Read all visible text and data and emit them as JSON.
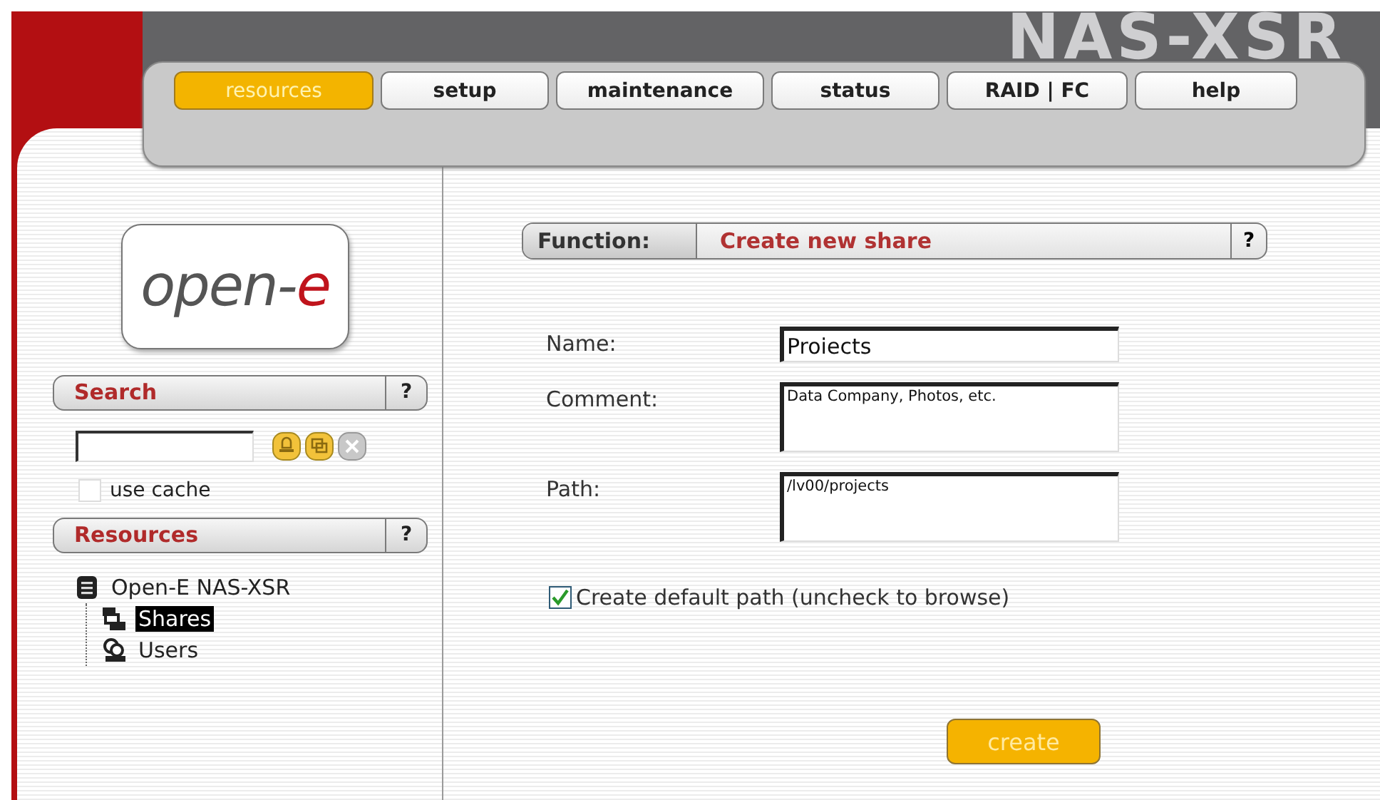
{
  "brand": {
    "title": "NAS-XSR"
  },
  "nav": {
    "tabs": [
      {
        "label": "resources",
        "selected": true
      },
      {
        "label": "setup",
        "selected": false
      },
      {
        "label": "maintenance",
        "selected": false
      },
      {
        "label": "status",
        "selected": false
      },
      {
        "label": "RAID | FC",
        "selected": false
      },
      {
        "label": "help",
        "selected": false
      }
    ]
  },
  "sidebar": {
    "logo": {
      "text": "open-",
      "accent": "e"
    },
    "search": {
      "title": "Search",
      "help": "?",
      "use_cache": {
        "label": "use cache",
        "checked": false
      }
    },
    "resources": {
      "title": "Resources",
      "help": "?",
      "tree": [
        {
          "label": "Open-E NAS-XSR",
          "kind": "server",
          "selected": false,
          "children": [
            {
              "label": "Shares",
              "kind": "shares",
              "selected": true
            },
            {
              "label": "Users",
              "kind": "users",
              "selected": false
            }
          ]
        }
      ]
    }
  },
  "function_bar": {
    "label": "Function:",
    "title": "Create new share",
    "help": "?"
  },
  "form": {
    "fields": [
      {
        "label": "Name:",
        "value": "Proiects",
        "kind": "line"
      },
      {
        "label": "Comment:",
        "value": "Data Company, Photos, etc.",
        "kind": "area"
      },
      {
        "label": "Path:",
        "value": "/lv00/projects",
        "kind": "area"
      }
    ],
    "default_path": {
      "label": "Create default path (uncheck to browse)",
      "checked": true
    },
    "create_button": "create"
  }
}
